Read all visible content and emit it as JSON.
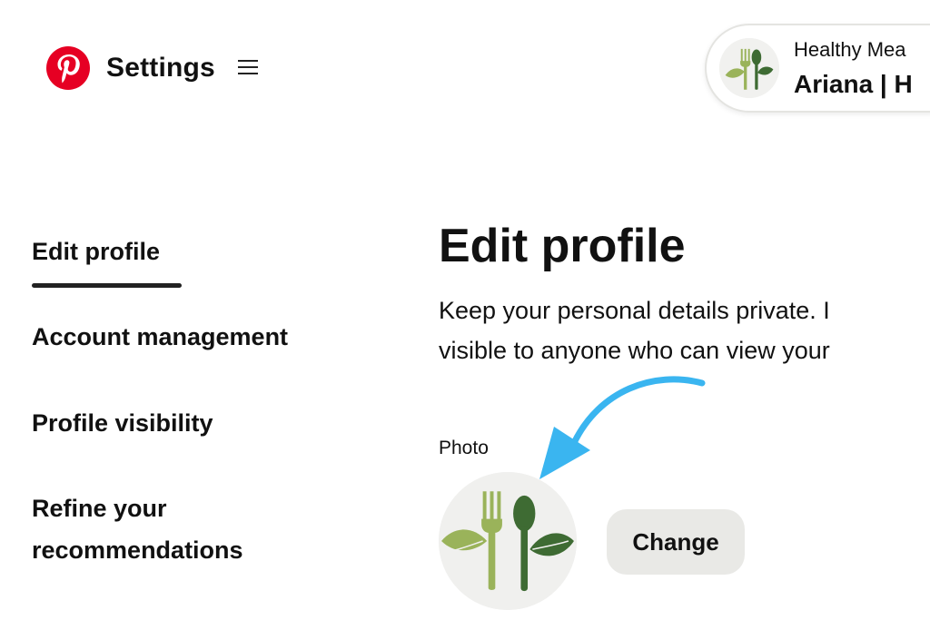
{
  "header": {
    "logo_icon": "pinterest-logo-icon",
    "title": "Settings",
    "menu_icon": "hamburger-menu-icon",
    "account": {
      "subtitle": "Healthy Mea",
      "name": "Ariana | H",
      "avatar_icon": "fork-spoon-leaves-icon"
    }
  },
  "sidebar": {
    "items": [
      {
        "label": "Edit profile",
        "active": true
      },
      {
        "label": "Account management"
      },
      {
        "label": "Profile visibility"
      },
      {
        "label": "Refine your recommendations"
      }
    ]
  },
  "main": {
    "title": "Edit profile",
    "description_line1": "Keep your personal details private. I",
    "description_line2": "visible to anyone who can view your",
    "photo_label": "Photo",
    "change_button": "Change",
    "photo_icon": "fork-spoon-leaves-icon",
    "annotation_icon": "blue-curved-arrow-icon"
  },
  "colors": {
    "brand_red": "#e60023",
    "arrow_blue": "#3ab5f0",
    "leaf_light": "#9ab35a",
    "leaf_dark": "#3e6b33",
    "button_bg": "#e9e9e6"
  }
}
